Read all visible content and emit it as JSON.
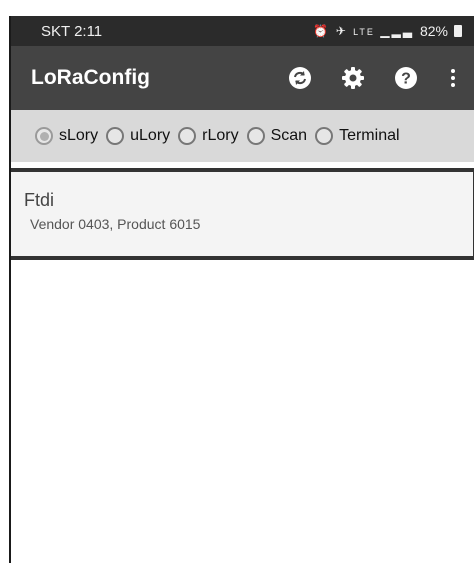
{
  "status_bar": {
    "carrier_time": "SKT 2:11",
    "icons": "⏰ ✈ LTE ▁▂▃",
    "battery": "82%"
  },
  "app_bar": {
    "title": "LoRaConfig",
    "actions": [
      {
        "icon": "sync-icon"
      },
      {
        "icon": "gear-icon"
      },
      {
        "icon": "help-icon"
      },
      {
        "icon": "overflow-menu-icon"
      }
    ]
  },
  "mode_selector": {
    "options": [
      {
        "label": "sLory",
        "checked": true
      },
      {
        "label": "uLory",
        "checked": false
      },
      {
        "label": "rLory",
        "checked": false
      },
      {
        "label": "Scan",
        "checked": false
      },
      {
        "label": "Terminal",
        "checked": false
      }
    ]
  },
  "devices": [
    {
      "name": "Ftdi",
      "description": "Vendor 0403, Product 6015"
    }
  ]
}
